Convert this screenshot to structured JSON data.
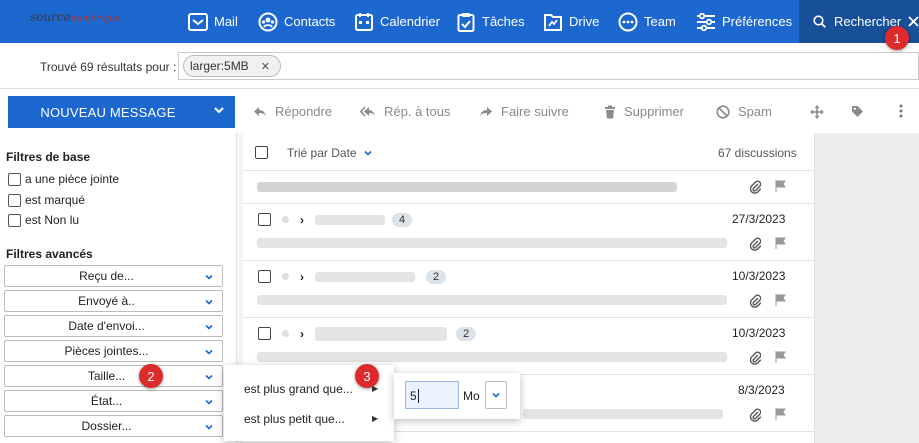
{
  "app": {
    "logo_main": "source",
    "logo_sub": "numérique"
  },
  "nav": {
    "mail": "Mail",
    "contacts": "Contacts",
    "calendar": "Calendrier",
    "tasks": "Tâches",
    "drive": "Drive",
    "team": "Team",
    "preferences": "Préférences",
    "search": "Rechercher"
  },
  "badges": [
    "1",
    "2",
    "3"
  ],
  "search": {
    "results_label": "Trouvé 69 résultats pour :",
    "chip": "larger:5MB"
  },
  "toolbar": {
    "new_message": "NOUVEAU MESSAGE",
    "reply": "Répondre",
    "reply_all": "Rép. à tous",
    "forward": "Faire suivre",
    "delete": "Supprimer",
    "spam": "Spam"
  },
  "filters": {
    "basic_title": "Filtres de base",
    "attachment": "a une pièce jointe",
    "flagged": "est marqué",
    "unread": "est Non lu",
    "advanced_title": "Filtres avancés",
    "received_from": "Reçu de...",
    "sent_to": "Envoyé à..",
    "send_date": "Date d'envoi...",
    "attachments": "Pièces jointes...",
    "size": "Taille...",
    "status": "État...",
    "folder": "Dossier..."
  },
  "list": {
    "sort_label": "Trié par Date",
    "count_label": "67 discussions",
    "rows": [
      {
        "date": "",
        "count": ""
      },
      {
        "date": "27/3/2023",
        "count": "4"
      },
      {
        "date": "10/3/2023",
        "count": "2"
      },
      {
        "date": "10/3/2023",
        "count": "2"
      },
      {
        "date": "8/3/2023",
        "count": ""
      }
    ]
  },
  "size_menu": {
    "greater": "est plus grand que...",
    "smaller": "est plus petit que...",
    "value": "5",
    "unit": "Mo"
  },
  "colors": {
    "brand_blue": "#1c68cf",
    "search_tab": "#174f99",
    "badge_red": "#dd2b2b"
  }
}
